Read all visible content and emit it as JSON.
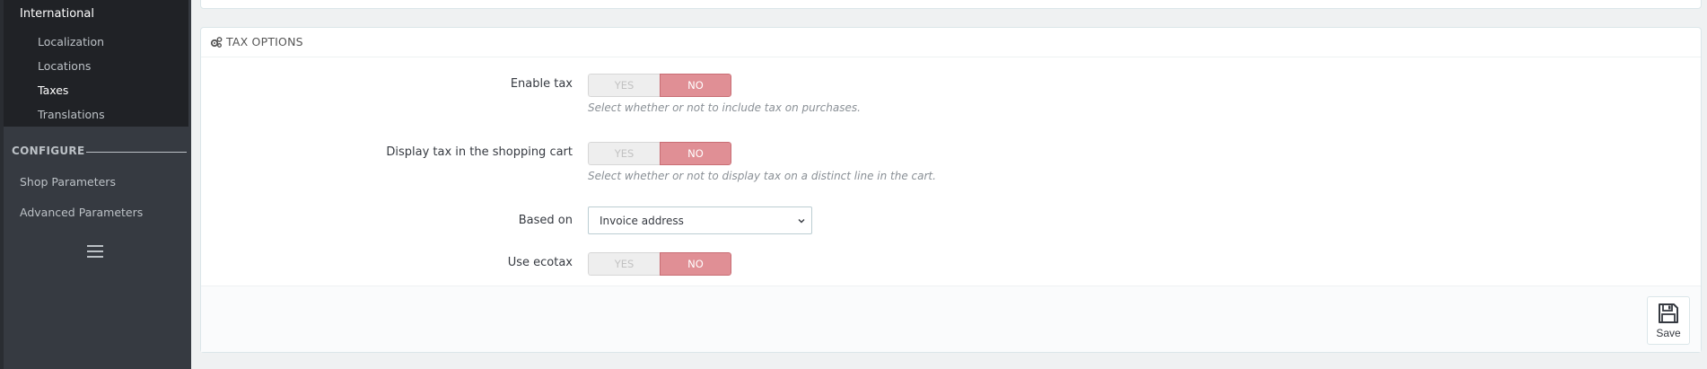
{
  "sidebar": {
    "parent": "International",
    "sub_items": [
      {
        "label": "Localization",
        "active": false
      },
      {
        "label": "Locations",
        "active": false
      },
      {
        "label": "Taxes",
        "active": true
      },
      {
        "label": "Translations",
        "active": false
      }
    ],
    "section_title": "CONFIGURE",
    "main_items": [
      {
        "label": "Shop Parameters"
      },
      {
        "label": "Advanced Parameters"
      }
    ],
    "menu_icon": "hamburger-icon"
  },
  "panel": {
    "title": "TAX OPTIONS",
    "icon": "gears-icon",
    "fields": {
      "enable_tax": {
        "label": "Enable tax",
        "yes": "YES",
        "no": "NO",
        "value": "NO",
        "help": "Select whether or not to include tax on purchases."
      },
      "display_tax_cart": {
        "label": "Display tax in the shopping cart",
        "yes": "YES",
        "no": "NO",
        "value": "NO",
        "help": "Select whether or not to display tax on a distinct line in the cart."
      },
      "based_on": {
        "label": "Based on",
        "value": "Invoice address"
      },
      "use_ecotax": {
        "label": "Use ecotax",
        "yes": "YES",
        "no": "NO",
        "value": "NO"
      }
    },
    "save_label": "Save"
  },
  "colors": {
    "sidebar_bg": "#363a41",
    "sidebar_active_bg": "#202226",
    "switch_no_active": "#e08f95",
    "switch_off": "#eeeeee"
  }
}
